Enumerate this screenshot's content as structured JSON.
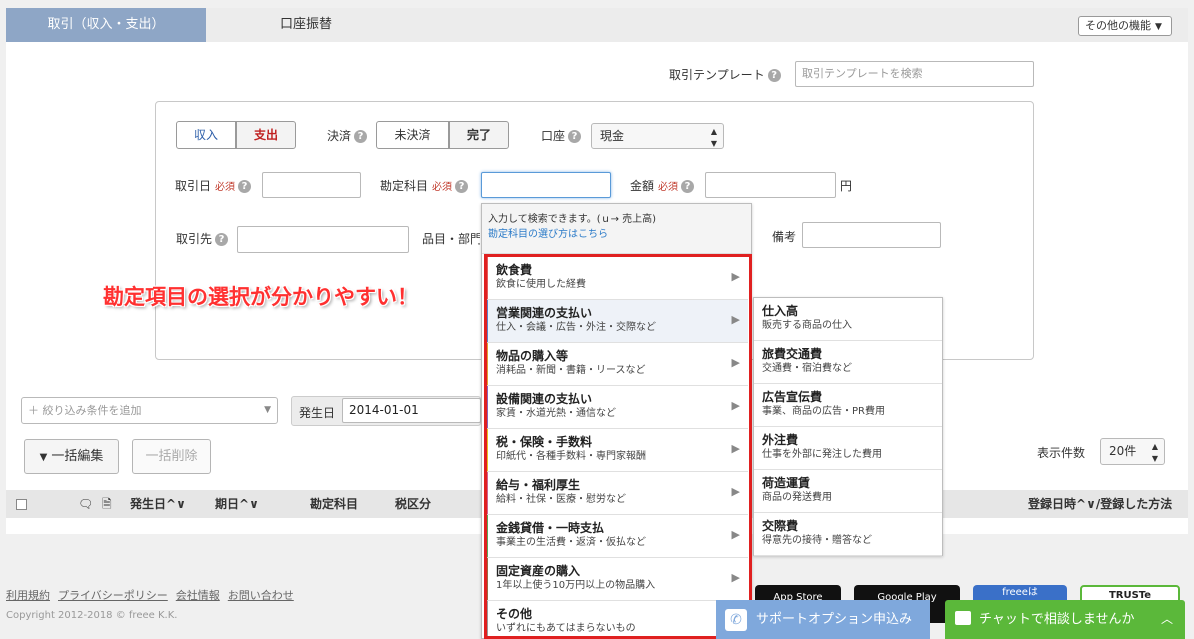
{
  "tabs": [
    {
      "label": "取引（収入・支出）"
    },
    {
      "label": "口座振替"
    }
  ],
  "other_button": "その他の機能",
  "template": {
    "label": "取引テンプレート",
    "placeholder": "取引テンプレートを検索"
  },
  "form": {
    "income": "収入",
    "expense": "支出",
    "settlement_label": "決済",
    "unsettled": "未決済",
    "done": "完了",
    "account_label": "口座",
    "account_value": "現金",
    "date_label": "取引日",
    "required": "必須",
    "subject_label": "勘定科目",
    "amount_label": "金額",
    "yen": "円",
    "partner_label": "取引先",
    "item_label": "品目・部門",
    "memo_label": "備考"
  },
  "dropdown": {
    "hint": "入力して検索できます。(ｕ→ 売上高)",
    "link": "勘定科目の選び方はこちら",
    "categories": [
      {
        "title": "飲食費",
        "desc": "飲食に使用した経費"
      },
      {
        "title": "営業関連の支払い",
        "desc": "仕入・会議・広告・外注・交際など"
      },
      {
        "title": "物品の購入等",
        "desc": "消耗品・新聞・書籍・リースなど"
      },
      {
        "title": "設備関連の支払い",
        "desc": "家賃・水道光熱・通信など"
      },
      {
        "title": "税・保険・手数料",
        "desc": "印紙代・各種手数料・専門家報酬"
      },
      {
        "title": "給与・福利厚生",
        "desc": "給料・社保・医療・慰労など"
      },
      {
        "title": "金銭貸借・一時支払",
        "desc": "事業主の生活費・返済・仮払など"
      },
      {
        "title": "固定資産の購入",
        "desc": "1年以上使う10万円以上の物品購入"
      },
      {
        "title": "その他",
        "desc": "いずれにもあてはまらないもの"
      }
    ],
    "accent_colors": [
      "#e45b5b",
      "#5b7fc9",
      "#e0a030",
      "#8a60b8",
      "#e8c020",
      "#d06090",
      "#58a858",
      "#9a6a40",
      "#999999"
    ]
  },
  "submenu": [
    {
      "title": "仕入高",
      "desc": "販売する商品の仕入"
    },
    {
      "title": "旅費交通費",
      "desc": "交通費・宿泊費など"
    },
    {
      "title": "広告宣伝費",
      "desc": "事業、商品の広告・PR費用"
    },
    {
      "title": "外注費",
      "desc": "仕事を外部に発注した費用"
    },
    {
      "title": "荷造運賃",
      "desc": "商品の発送費用"
    },
    {
      "title": "交際費",
      "desc": "得意先の接待・贈答など"
    }
  ],
  "annotation": "勘定項目の選択が分かりやすい！",
  "filter": {
    "placeholder": "＋ 絞り込み条件を追加",
    "date_label": "発生日",
    "date_value": "2014-01-01"
  },
  "bulk_edit": "一括編集",
  "bulk_delete": "一括削除",
  "page_size_label": "表示件数",
  "page_size_value": "20件",
  "table_headers": {
    "occurred": "発生日",
    "due": "期日",
    "subject": "勘定科目",
    "tax": "税区分",
    "registered": "登録日時",
    "method": "登録した方法"
  },
  "footer": {
    "links": [
      "利用規約",
      "プライバシーポリシー",
      "会社情報",
      "お問い合わせ"
    ],
    "copyright": "Copyright 2012-2018 © freee K.K.",
    "badges": [
      "App Store",
      "Google Play",
      "freeeは",
      "TRUSTe"
    ]
  },
  "support_button": "サポートオプション申込み",
  "chat_button": "チャットで相談しませんか"
}
